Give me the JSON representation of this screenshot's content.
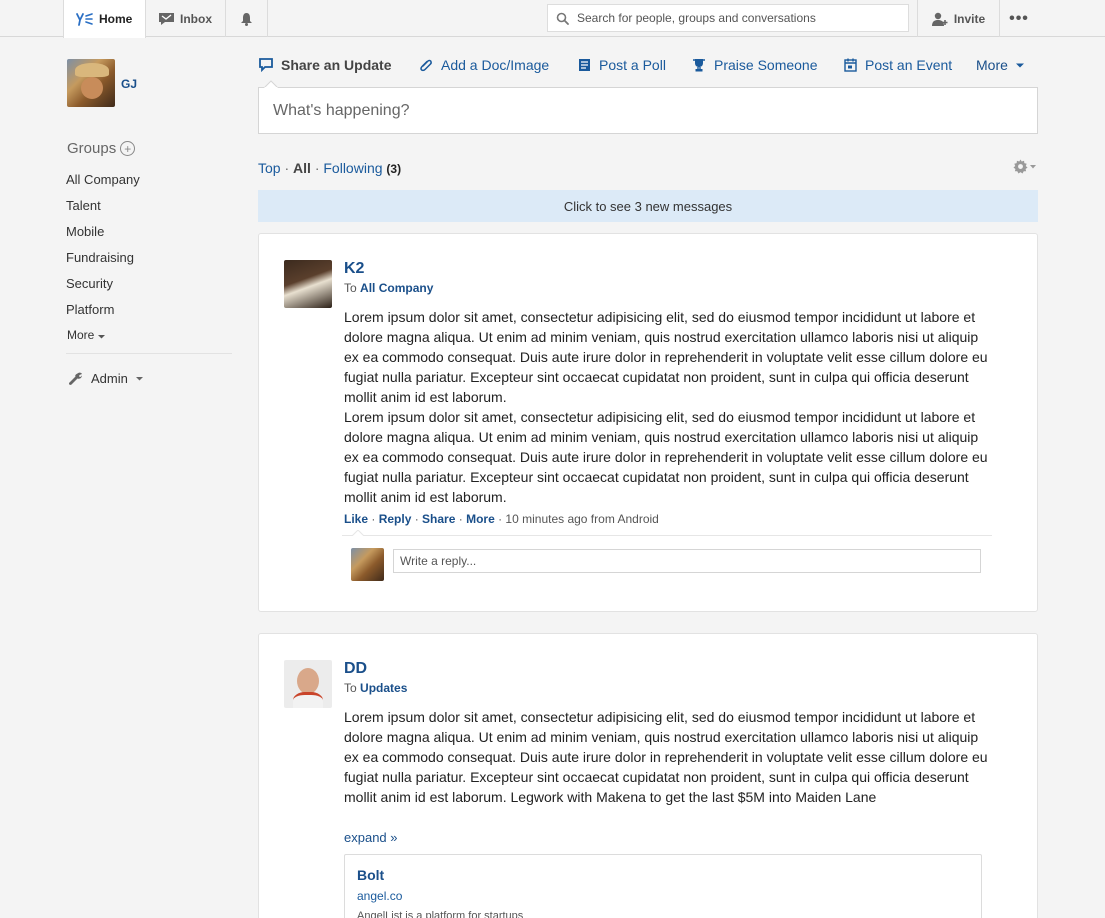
{
  "nav": {
    "home_label": "Home",
    "inbox_label": "Inbox",
    "search_placeholder": "Search for people, groups and conversations",
    "invite_label": "Invite",
    "more_label": "•••"
  },
  "user": {
    "initials": "GJ"
  },
  "sidebar": {
    "groups_heading": "Groups",
    "groups": [
      "All Company",
      "Talent",
      "Mobile",
      "Fundraising",
      "Security",
      "Platform"
    ],
    "more_label": "More",
    "admin_label": "Admin"
  },
  "publisher": {
    "tabs": [
      "Share an Update",
      "Add a Doc/Image",
      "Post a Poll",
      "Praise Someone",
      "Post an Event"
    ],
    "more_label": "More",
    "placeholder": "What's happening?"
  },
  "filter": {
    "top": "Top",
    "all": "All",
    "following": "Following",
    "following_count": "(3)"
  },
  "new_messages": "Click to see 3 new messages",
  "posts": [
    {
      "author": "K2",
      "to_prefix": "To",
      "to_group": "All Company",
      "paragraphs": [
        "Lorem ipsum dolor sit amet, consectetur adipisicing elit, sed do eiusmod tempor incididunt ut labore et dolore magna aliqua. Ut enim ad minim veniam, quis nostrud exercitation ullamco laboris nisi ut aliquip ex ea commodo consequat. Duis aute irure dolor in reprehenderit in voluptate velit esse cillum dolore eu fugiat nulla pariatur. Excepteur sint occaecat cupidatat non proident, sunt in culpa qui officia deserunt mollit anim id est laborum.",
        "Lorem ipsum dolor sit amet, consectetur adipisicing elit, sed do eiusmod tempor incididunt ut labore et dolore magna aliqua. Ut enim ad minim veniam, quis nostrud exercitation ullamco laboris nisi ut aliquip ex ea commodo consequat. Duis aute irure dolor in reprehenderit in voluptate velit esse cillum dolore eu fugiat nulla pariatur. Excepteur sint occaecat cupidatat non proident, sunt in culpa qui officia deserunt mollit anim id est laborum."
      ],
      "actions": {
        "like": "Like",
        "reply": "Reply",
        "share": "Share",
        "more": "More",
        "meta": "10 minutes ago from Android"
      },
      "reply_placeholder": "Write a reply..."
    },
    {
      "author": "DD",
      "to_prefix": "To",
      "to_group": "Updates",
      "paragraphs": [
        "Lorem ipsum dolor sit amet, consectetur adipisicing elit, sed do eiusmod tempor incididunt ut labore et dolore magna aliqua. Ut enim ad minim veniam, quis nostrud exercitation ullamco laboris nisi ut aliquip ex ea commodo consequat. Duis aute irure dolor in reprehenderit in voluptate velit esse cillum dolore eu fugiat nulla pariatur. Excepteur sint occaecat cupidatat non proident, sunt in culpa qui officia deserunt mollit anim id est laborum. Legwork with Makena to get the last $5M into Maiden Lane"
      ],
      "expand_label": "expand »",
      "attachment": {
        "title": "Bolt",
        "url": "angel.co",
        "description": "AngelList is a platform for startups"
      }
    }
  ],
  "colors": {
    "link": "#1a5a9c",
    "name": "#1a4f8a",
    "new_messages_bg": "#dceaf7",
    "page_bg": "#f4f4f4"
  }
}
